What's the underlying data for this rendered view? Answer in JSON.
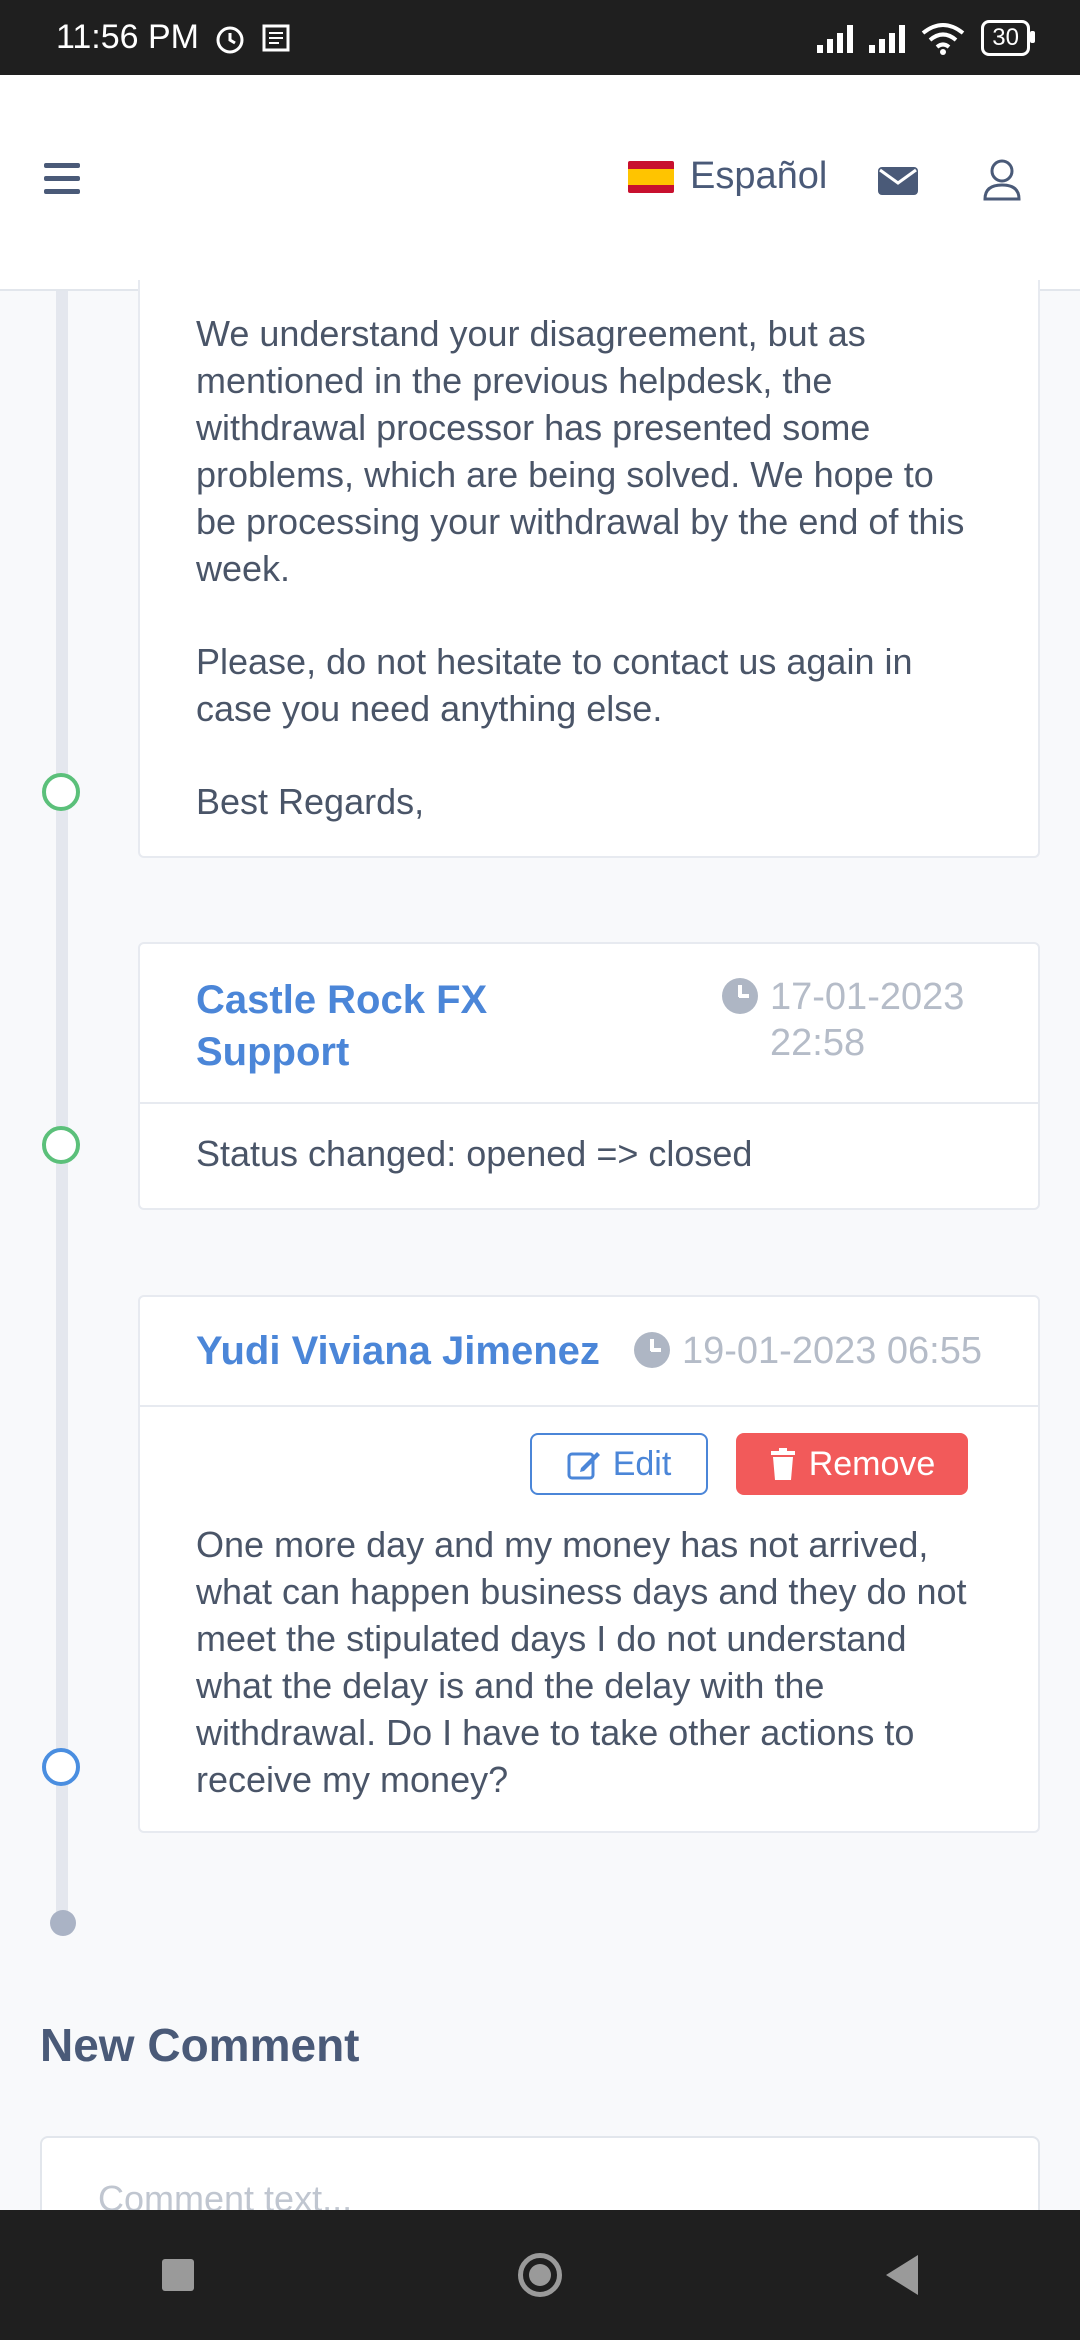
{
  "status_bar": {
    "time": "11:56 PM",
    "battery": "30"
  },
  "header": {
    "language": "Español"
  },
  "messages": [
    {
      "paragraphs": [
        "We understand your disagreement, but as mentioned in the previous helpdesk, the withdrawal processor has presented some problems, which are being solved. We hope to be processing your withdrawal by the end of this week.",
        "Please, do not hesitate to contact us again in case you need anything else.",
        "Best Regards,"
      ]
    },
    {
      "author": "Castle Rock FX Support",
      "timestamp": "17-01-2023 22:58",
      "body": "Status changed: opened => closed"
    },
    {
      "author": "Yudi Viviana Jimenez",
      "timestamp": "19-01-2023 06:55",
      "edit_label": "Edit",
      "remove_label": "Remove",
      "body": "One more day and my money has not arrived, what can happen business days and they do not meet the stipulated days I do not understand what the delay is and the delay with the withdrawal. Do I have to take other actions to receive my money?"
    }
  ],
  "new_comment": {
    "title": "New Comment",
    "placeholder": "Comment text..."
  },
  "colors": {
    "accent": "#4b86d8",
    "danger": "#f25a5a",
    "green_dot": "#5bc07a"
  }
}
